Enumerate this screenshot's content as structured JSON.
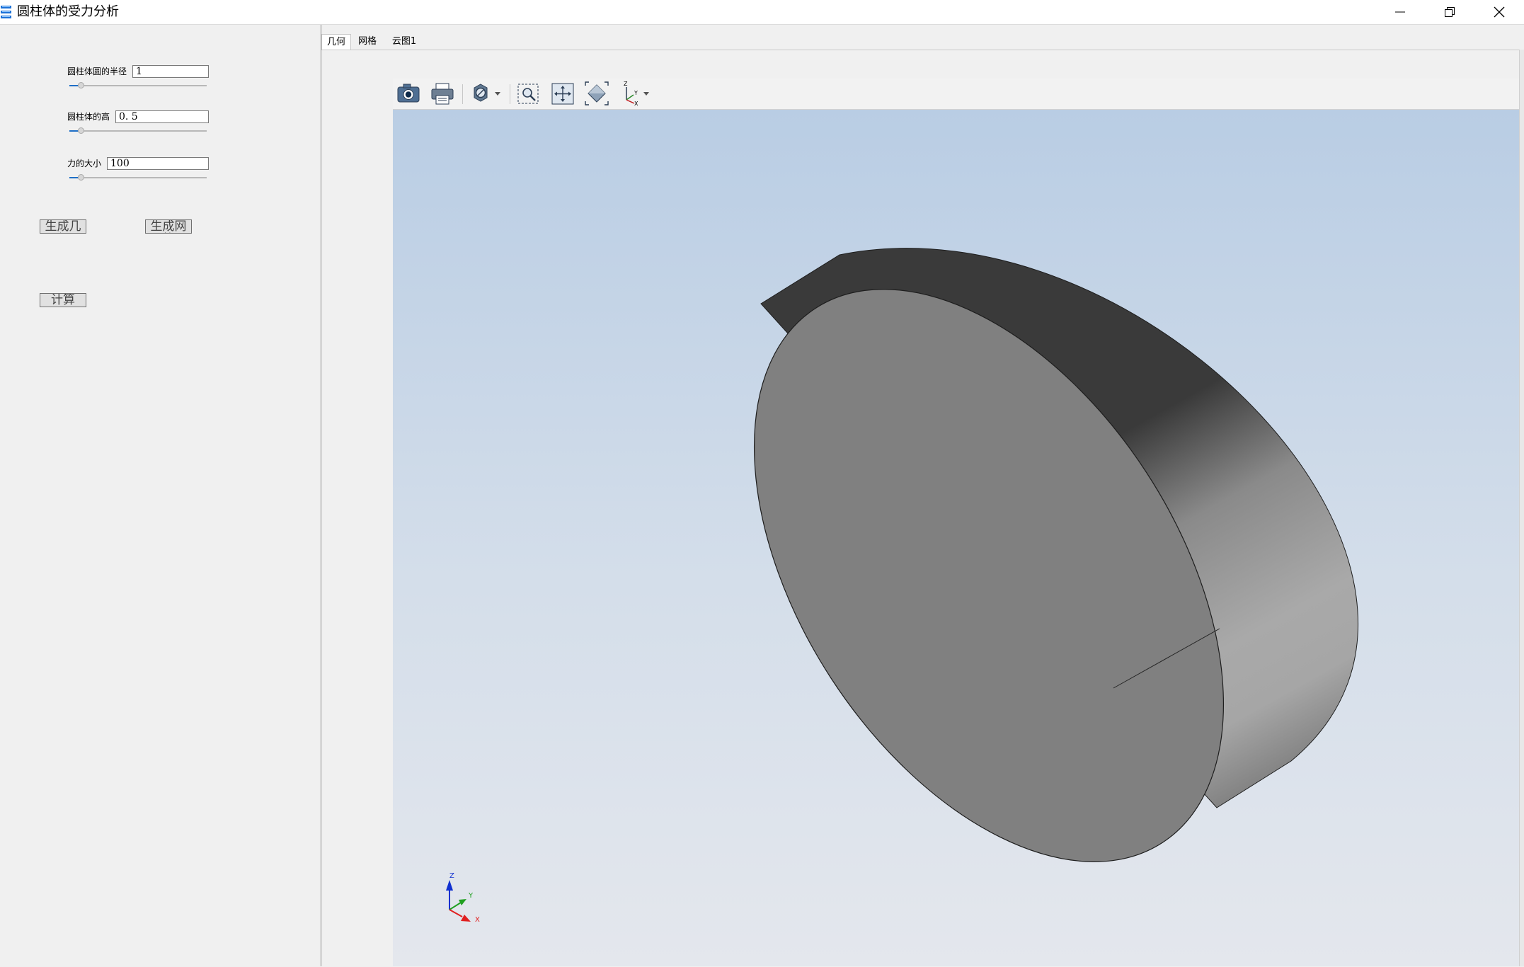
{
  "window": {
    "title": "圆柱体的受力分析",
    "icons": {
      "app": "app-layers-icon",
      "minimize": "minimize-icon",
      "maximize": "restore-icon",
      "close": "close-icon"
    }
  },
  "params": {
    "radius_label": "圆柱体圆的半径",
    "radius_value": "1",
    "height_label": "圆柱体的高",
    "height_value": "0. 5",
    "force_label": "力的大小",
    "force_value": "100"
  },
  "buttons": {
    "gen_geometry": "生成几何",
    "gen_mesh": "生成网格",
    "compute": "计算"
  },
  "tabs": [
    {
      "label": "几何",
      "active": true
    },
    {
      "label": "网格",
      "active": false
    },
    {
      "label": "云图1",
      "active": false
    }
  ],
  "toolbar": {
    "icons": [
      "camera-icon",
      "printer-icon",
      "display-mode-icon",
      "zoom-window-icon",
      "pan-icon",
      "fit-all-icon",
      "view-axes-icon"
    ]
  },
  "axis_triad": {
    "z": "Z",
    "y": "Y",
    "x": "X"
  },
  "colors": {
    "viewport_top": "#b9cde4",
    "viewport_bottom": "#e4e7ed",
    "solid_face": "#808080",
    "axis_z": "#1030d0",
    "axis_y": "#20a020",
    "axis_x": "#e02020",
    "slider_fill": "#1f6fc6"
  }
}
